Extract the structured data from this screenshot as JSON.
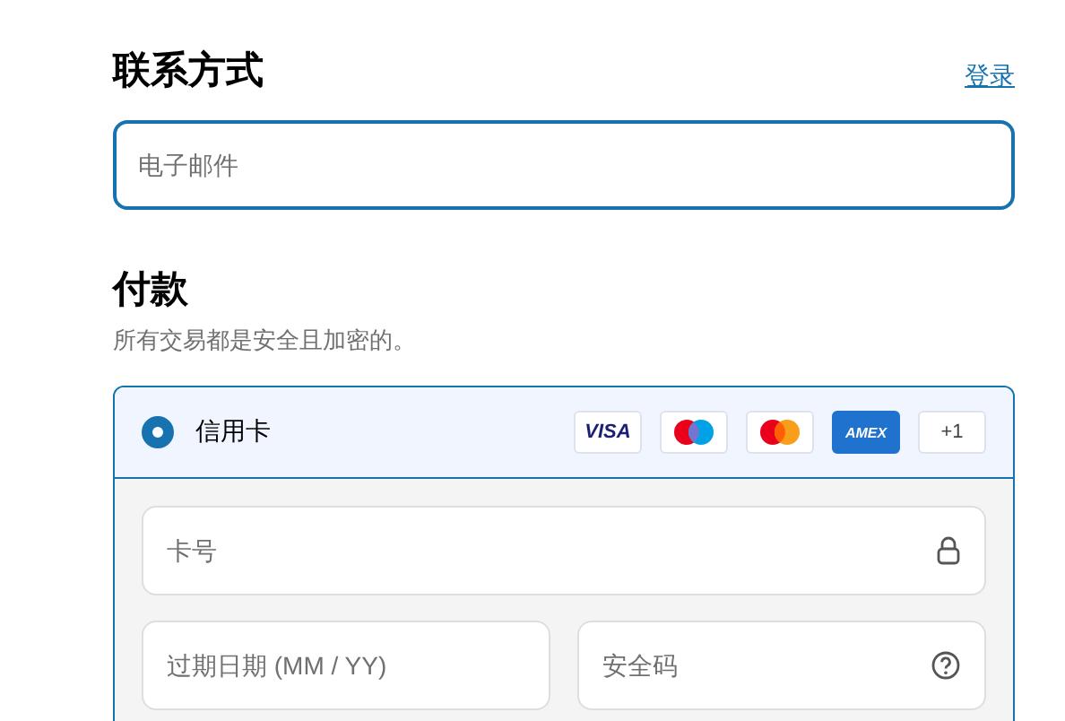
{
  "contact": {
    "title": "联系方式",
    "login_link": "登录",
    "email": {
      "placeholder": "电子邮件",
      "focused": true
    }
  },
  "payment": {
    "title": "付款",
    "subtitle": "所有交易都是安全且加密的。",
    "methods": [
      {
        "label": "信用卡",
        "selected": true,
        "cards": [
          {
            "kind": "visa",
            "label": "VISA"
          },
          {
            "kind": "maestro"
          },
          {
            "kind": "mastercard"
          },
          {
            "kind": "amex",
            "label": "AMEX"
          }
        ],
        "more": "+1",
        "fields": [
          {
            "kind": "card_number",
            "placeholder": "卡号"
          },
          {
            "kind": "expiry",
            "placeholder": "过期日期 (MM / YY)"
          },
          {
            "kind": "security_code",
            "placeholder": "安全码"
          }
        ]
      }
    ]
  }
}
